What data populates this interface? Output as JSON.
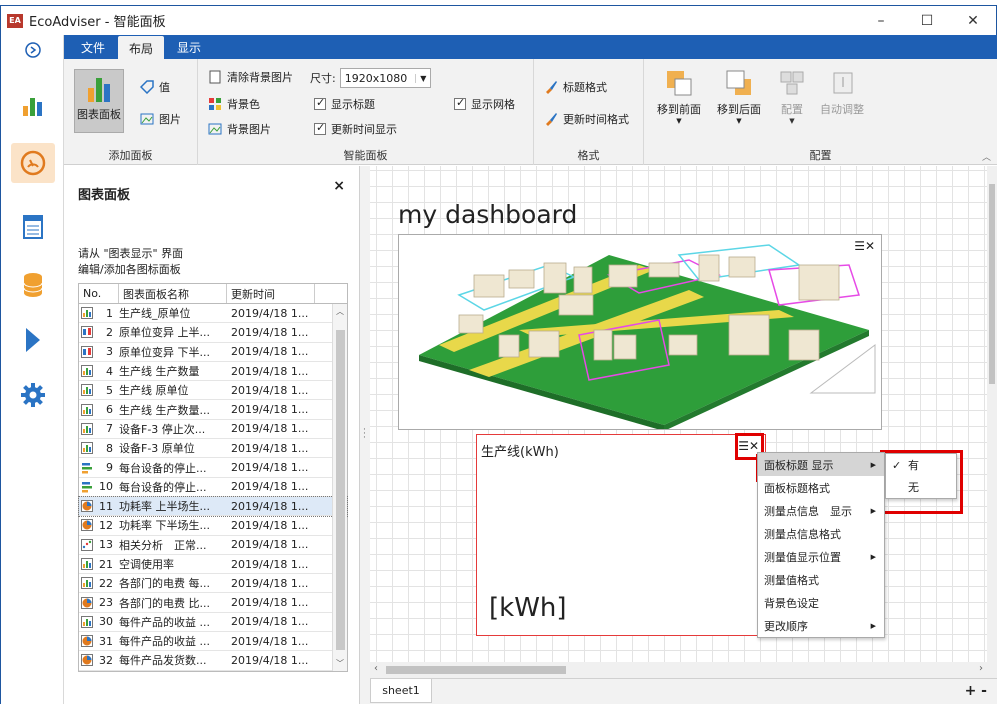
{
  "window": {
    "title": "EcoAdviser - 智能面板",
    "logo": "EA",
    "overlay_text": "",
    "buttons": [
      "–",
      "☐",
      "✕"
    ]
  },
  "rail": {
    "items": [
      "arrow-right-icon",
      "bar-chart-icon",
      "gauge-icon",
      "report-icon",
      "database-icon",
      "play-icon",
      "gear-icon"
    ]
  },
  "tabs": [
    "文件",
    "布局",
    "显示"
  ],
  "ribbon": {
    "groups": {
      "add_panel": {
        "label": "添加面板",
        "chart_panel": "图表面板",
        "value": "值",
        "image": "图片"
      },
      "smart_panel": {
        "label": "智能面板",
        "clear_bg": "清除背景图片",
        "size_label": "尺寸:",
        "size_value": "1920x1080",
        "bg_color": "背景色",
        "show_title": "显示标题",
        "show_grid": "显示网格",
        "bg_image": "背景图片",
        "update_time": "更新时间显示"
      },
      "format": {
        "label": "格式",
        "title_format": "标题格式",
        "time_format": "更新时间格式"
      },
      "arrange": {
        "label": "配置",
        "bring_front": "移到前面",
        "send_back": "移到后面",
        "arrange": "配置",
        "auto_adjust": "自动调整"
      }
    }
  },
  "left_panel": {
    "title": "图表面板",
    "close": "×",
    "hint_line1": "请从 \"图表显示\" 界面",
    "hint_line2": "编辑/添加各图标面板",
    "columns": [
      "No.",
      "图表面板名称",
      "更新时间"
    ],
    "rows": [
      {
        "icon": "bar",
        "no": "1",
        "name": "生产线_原单位",
        "time": "2019/4/18 1..."
      },
      {
        "icon": "box",
        "no": "2",
        "name": "原单位变异 上半...",
        "time": "2019/4/18 1..."
      },
      {
        "icon": "box",
        "no": "3",
        "name": "原单位变异 下半...",
        "time": "2019/4/18 1..."
      },
      {
        "icon": "bar",
        "no": "4",
        "name": "生产线 生产数量",
        "time": "2019/4/18 1..."
      },
      {
        "icon": "bar",
        "no": "5",
        "name": "生产线 原单位",
        "time": "2019/4/18 1..."
      },
      {
        "icon": "bar",
        "no": "6",
        "name": "生产线 生产数量...",
        "time": "2019/4/18 1..."
      },
      {
        "icon": "bar",
        "no": "7",
        "name": "设备F-3 停止次...",
        "time": "2019/4/18 1..."
      },
      {
        "icon": "bar",
        "no": "8",
        "name": "设备F-3 原单位",
        "time": "2019/4/18 1..."
      },
      {
        "icon": "hbar",
        "no": "9",
        "name": "每台设备的停止...",
        "time": "2019/4/18 1..."
      },
      {
        "icon": "hbar",
        "no": "10",
        "name": "每台设备的停止...",
        "time": "2019/4/18 1..."
      },
      {
        "icon": "pie",
        "no": "11",
        "name": "功耗率 上半场生...",
        "time": "2019/4/18 1...",
        "selected": true
      },
      {
        "icon": "pie",
        "no": "12",
        "name": "功耗率 下半场生...",
        "time": "2019/4/18 1..."
      },
      {
        "icon": "scatter",
        "no": "13",
        "name": "相关分析　正常...",
        "time": "2019/4/18 1..."
      },
      {
        "icon": "bar",
        "no": "21",
        "name": "空调使用率",
        "time": "2019/4/18 1..."
      },
      {
        "icon": "bar",
        "no": "22",
        "name": "各部门的电费 每...",
        "time": "2019/4/18 1..."
      },
      {
        "icon": "pie",
        "no": "23",
        "name": "各部门的电费 比...",
        "time": "2019/4/18 1..."
      },
      {
        "icon": "bar",
        "no": "30",
        "name": "每件产品的收益 ...",
        "time": "2019/4/18 1..."
      },
      {
        "icon": "pie",
        "no": "31",
        "name": "每件产品的收益 ...",
        "time": "2019/4/18 1..."
      },
      {
        "icon": "pie",
        "no": "32",
        "name": "每件产品发货数...",
        "time": "2019/4/18 1..."
      }
    ]
  },
  "canvas": {
    "dashboard_title": "my dashboard",
    "panel2_title": "生产线(kWh)",
    "panel2_unit": "[kWh]",
    "panel_tools": "☰✕"
  },
  "context_menu": {
    "items": [
      {
        "label": "面板标题 显示",
        "submenu": true,
        "highlight": true
      },
      {
        "label": "面板标题格式",
        "submenu": false
      },
      {
        "label": "测量点信息　显示",
        "submenu": true
      },
      {
        "label": "测量点信息格式",
        "submenu": false
      },
      {
        "label": "测量值显示位置",
        "submenu": true
      },
      {
        "label": "测量值格式",
        "submenu": false
      },
      {
        "label": "背景色设定",
        "submenu": false
      },
      {
        "label": "更改顺序",
        "submenu": true
      }
    ],
    "submenu": [
      {
        "label": "有",
        "checked": true
      },
      {
        "label": "无",
        "checked": false
      }
    ]
  },
  "sheet": {
    "tab": "sheet1",
    "add": "+ -"
  },
  "colors": {
    "accent": "#1e5fb4",
    "highlight_box": "#e00000",
    "panel_border": "#e53a3a"
  }
}
